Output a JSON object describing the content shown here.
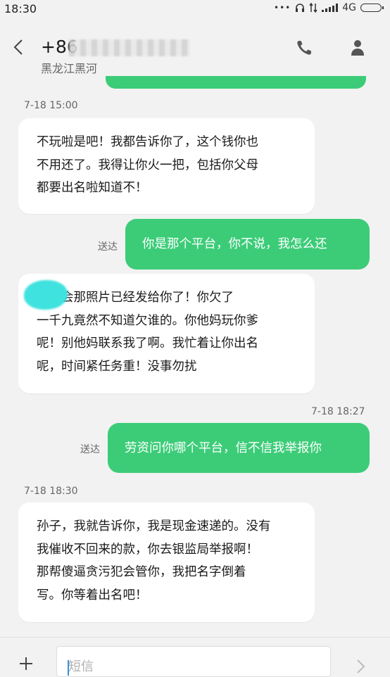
{
  "status_bar": {
    "time": "18:30",
    "dots": "•••",
    "network": "4G"
  },
  "header": {
    "contact_number": "+86",
    "contact_location": "黑龙江黑河",
    "back_icon": "chevron-left-icon",
    "call_icon": "phone-icon",
    "contact_icon": "person-icon"
  },
  "messages": [
    {
      "timestamp": "7-18 15:00",
      "direction": "received",
      "text": "不玩啦是吧！我都告诉你了，这个钱你也\n不用还了。我得让你火一把，包括你父母\n都要出名啦知道不！"
    },
    {
      "direction": "sent",
      "status": "送达",
      "text": "你是那个平台，你不说，我怎么还"
    },
    {
      "direction": "received",
      "text": "，那会那照片已经发给你了！你欠了\n一千九竟然不知道欠谁的。你他妈玩你爹\n呢！别他妈联系我了啊。我忙着让你出名\n呢，时间紧任务重！没事勿扰"
    },
    {
      "timestamp": "7-18 18:27",
      "direction": "sent",
      "status": "送达",
      "text": "劳资问你哪个平台，信不信我举报你"
    },
    {
      "timestamp": "7-18 18:30",
      "direction": "received",
      "text": "孙子，我就告诉你，我是现金速递的。没有\n我催收不回来的款，你去银监局举报啊！\n那帮傻逼贪污犯会管你，我把名字倒着\n写。你等着出名吧！"
    }
  ],
  "input_bar": {
    "placeholder": "短信",
    "add_icon": "plus-icon",
    "send_icon": "chevron-right-icon"
  },
  "colors": {
    "sent_bubble": "#3ccc78",
    "received_bubble": "#ffffff",
    "background": "#f2f2f2",
    "redaction_mark": "#3fe2df"
  }
}
